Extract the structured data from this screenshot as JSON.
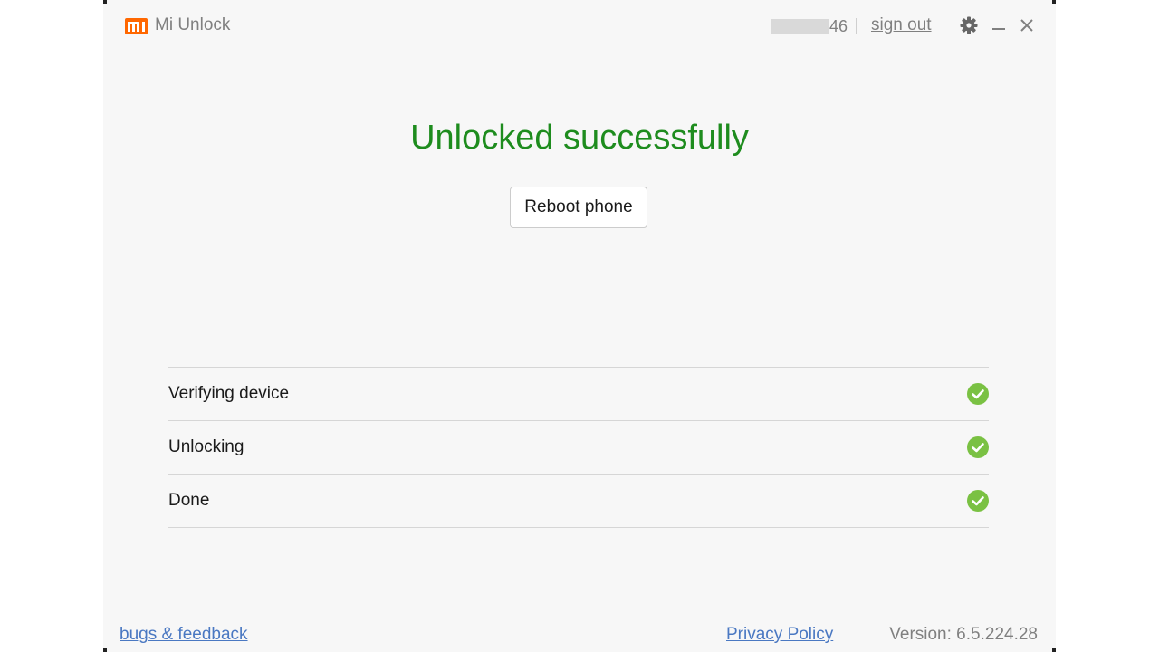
{
  "window": {
    "title": "Mi Unlock",
    "logo": "mi-logo"
  },
  "account": {
    "id_suffix": "46",
    "sign_out_label": "sign out"
  },
  "title_controls": {
    "settings_icon": "gear-icon",
    "minimize_icon": "minimize-icon",
    "close_icon": "close-icon"
  },
  "main": {
    "status_heading": "Unlocked successfully",
    "reboot_label": "Reboot phone"
  },
  "steps": [
    {
      "label": "Verifying device",
      "status": "complete"
    },
    {
      "label": "Unlocking",
      "status": "complete"
    },
    {
      "label": "Done",
      "status": "complete"
    }
  ],
  "footer": {
    "feedback_label": "bugs & feedback",
    "privacy_label": "Privacy Policy",
    "version_text": "Version: 6.5.224.28"
  },
  "colors": {
    "brand": "#ff6700",
    "success": "#1e8c1e",
    "check": "#7ac143",
    "link": "#4a78c2"
  }
}
